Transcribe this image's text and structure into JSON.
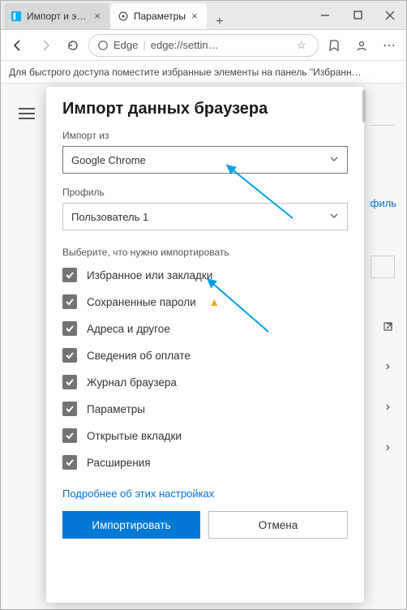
{
  "window": {
    "tabs": [
      {
        "label": "Импорт и эк…",
        "active": false
      },
      {
        "label": "Параметры",
        "active": true
      }
    ],
    "address_prefix": "Edge",
    "address": "edge://settin…"
  },
  "bookmarks_hint": "Для быстрого доступа поместите избранные элементы на панель \"Избранн…",
  "bg": {
    "profile_link": "филь"
  },
  "modal": {
    "title": "Импорт данных браузера",
    "import_from_label": "Импорт из",
    "import_from_value": "Google Chrome",
    "profile_label": "Профиль",
    "profile_value": "Пользователь 1",
    "choose_label": "Выберите, что нужно импортировать",
    "items": [
      {
        "label": "Избранное или закладки",
        "warn": false
      },
      {
        "label": "Сохраненные пароли",
        "warn": true
      },
      {
        "label": "Адреса и другое",
        "warn": false
      },
      {
        "label": "Сведения об оплате",
        "warn": false
      },
      {
        "label": "Журнал браузера",
        "warn": false
      },
      {
        "label": "Параметры",
        "warn": false
      },
      {
        "label": "Открытые вкладки",
        "warn": false
      },
      {
        "label": "Расширения",
        "warn": false
      }
    ],
    "learn_more": "Подробнее об этих настройках",
    "import_btn": "Импортировать",
    "cancel_btn": "Отмена"
  }
}
